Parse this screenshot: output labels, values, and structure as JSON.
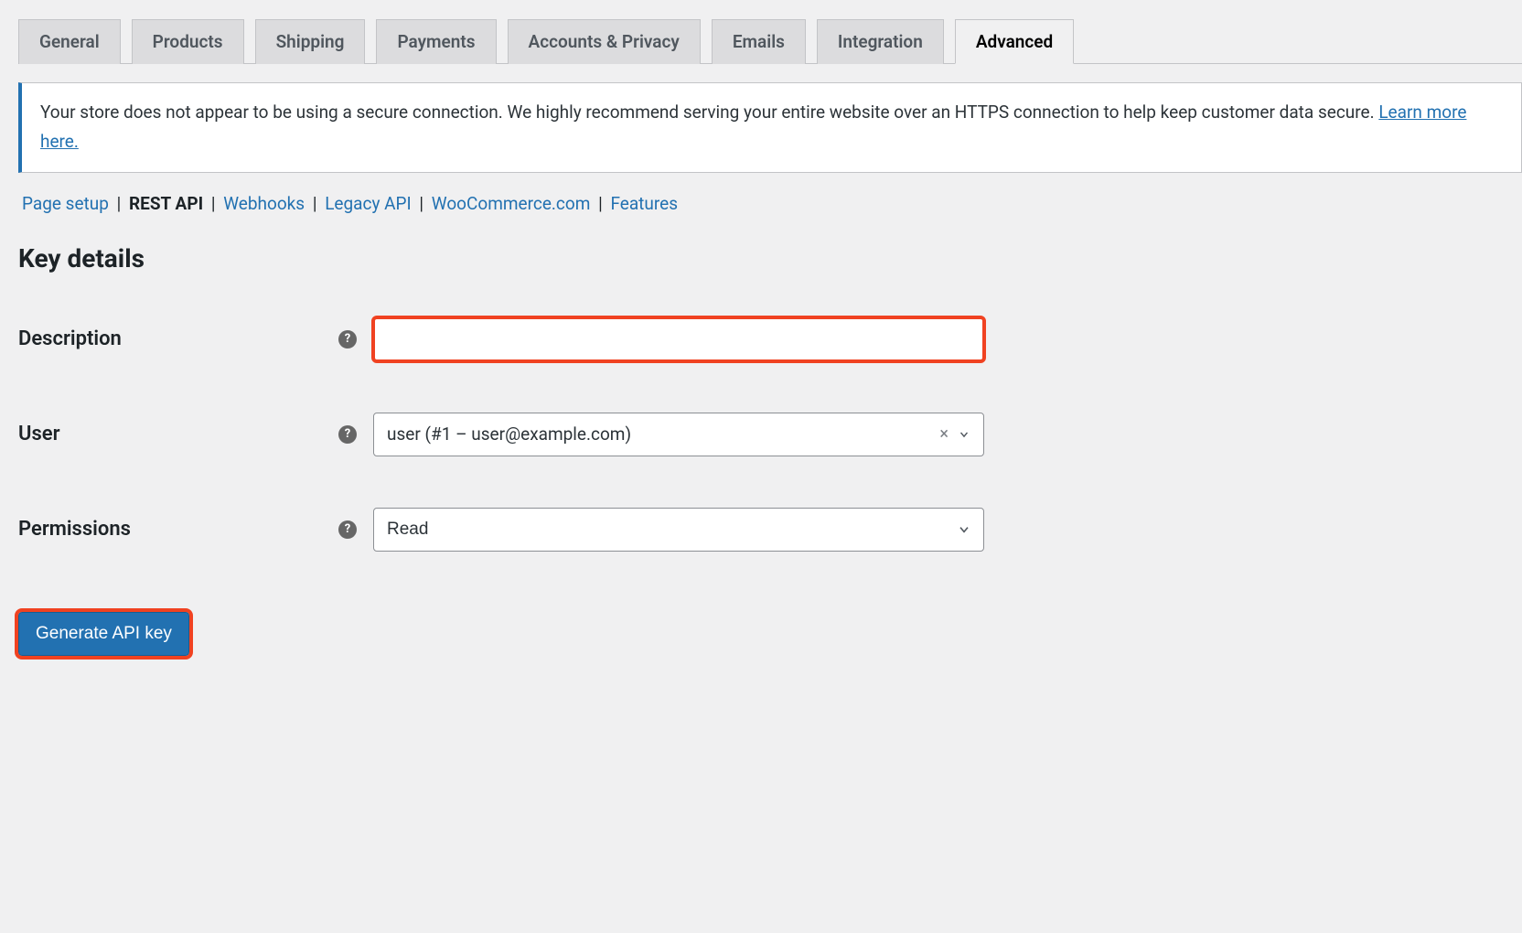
{
  "tabs": [
    {
      "label": "General"
    },
    {
      "label": "Products"
    },
    {
      "label": "Shipping"
    },
    {
      "label": "Payments"
    },
    {
      "label": "Accounts & Privacy"
    },
    {
      "label": "Emails"
    },
    {
      "label": "Integration"
    },
    {
      "label": "Advanced"
    }
  ],
  "active_tab_index": 7,
  "notice": {
    "text_before_link": "Your store does not appear to be using a secure connection. We highly recommend serving your entire website over an HTTPS connection to help keep customer data secure. ",
    "link_text": "Learn more here."
  },
  "subnav": {
    "items": [
      {
        "label": "Page setup",
        "current": false
      },
      {
        "label": "REST API",
        "current": true
      },
      {
        "label": "Webhooks",
        "current": false
      },
      {
        "label": "Legacy API",
        "current": false
      },
      {
        "label": "WooCommerce.com",
        "current": false
      },
      {
        "label": "Features",
        "current": false
      }
    ]
  },
  "section_title": "Key details",
  "form": {
    "description": {
      "label": "Description",
      "value": ""
    },
    "user": {
      "label": "User",
      "value": "user (#1 – user@example.com)"
    },
    "permissions": {
      "label": "Permissions",
      "value": "Read"
    }
  },
  "button": {
    "label": "Generate API key"
  }
}
